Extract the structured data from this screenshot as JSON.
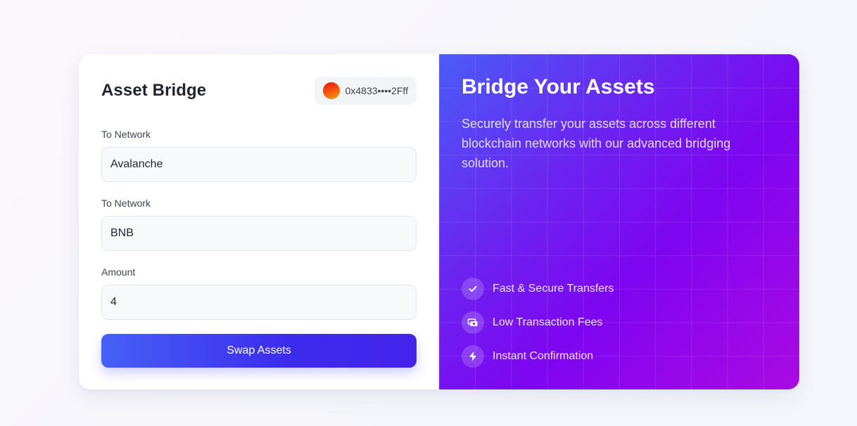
{
  "form": {
    "title": "Asset Bridge",
    "wallet_address": "0x4833••••2Fff",
    "fields": [
      {
        "label": "To Network",
        "value": "Avalanche"
      },
      {
        "label": "To Network",
        "value": "BNB"
      },
      {
        "label": "Amount",
        "value": "4"
      }
    ],
    "submit_label": "Swap Assets"
  },
  "promo": {
    "title": "Bridge Your Assets",
    "description": "Securely transfer your assets across different blockchain networks with our advanced bridging solution.",
    "features": [
      {
        "icon": "check-icon",
        "label": "Fast & Secure Transfers"
      },
      {
        "icon": "money-bill-icon",
        "label": "Low Transaction Fees"
      },
      {
        "icon": "lightning-bolt-icon",
        "label": "Instant Confirmation"
      }
    ]
  },
  "colors": {
    "accent": "#4523e9",
    "gradient_start": "#4a5cf7",
    "gradient_end": "#a90be0"
  }
}
